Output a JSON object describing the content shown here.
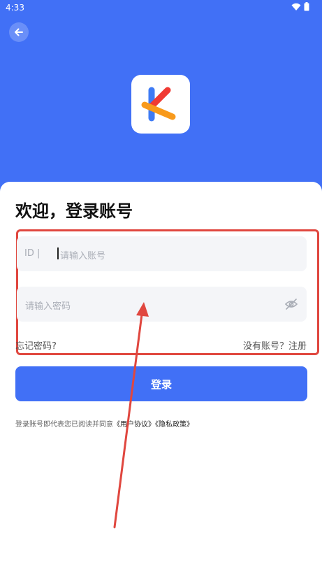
{
  "status_bar": {
    "time": "4:33",
    "icons": [
      "wifi-icon",
      "battery-icon"
    ]
  },
  "header": {
    "back_icon": "arrow-left-icon",
    "logo_icon": "app-logo-k"
  },
  "login": {
    "title": "欢迎，登录账号",
    "account_field": {
      "prefix": "ID |",
      "placeholder": "请输入账号"
    },
    "password_field": {
      "placeholder": "请输入密码",
      "toggle_icon": "eye-off-icon"
    },
    "forgot_password": "忘记密码?",
    "register": "没有账号？注册",
    "login_button": "登录",
    "agreement": {
      "prefix": "登录账号即代表您已阅读并同意",
      "user_agreement": "《用户协议》",
      "privacy_policy": "《隐私政策》"
    }
  },
  "colors": {
    "brand": "#4170F6",
    "annotation": "#E0473F",
    "field_bg": "#F4F5F8"
  }
}
